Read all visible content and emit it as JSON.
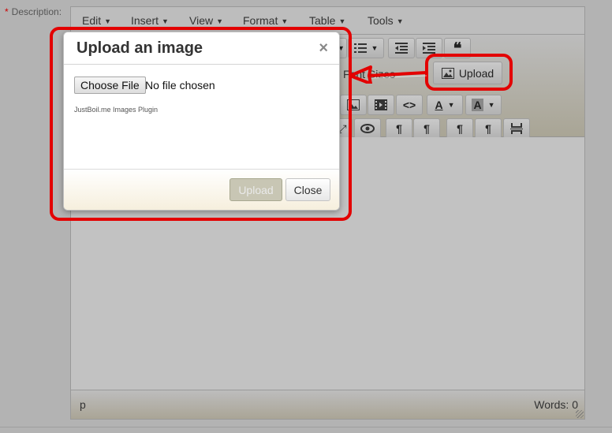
{
  "form": {
    "required_mark": "*",
    "description_label": "Description:"
  },
  "menubar": {
    "items": [
      "Edit",
      "Insert",
      "View",
      "Format",
      "Table",
      "Tools"
    ]
  },
  "toolbar": {
    "font_sizes_label": "Font Sizes",
    "upload_label": "Upload",
    "font_color_letter": "A",
    "bg_color_letter": "A"
  },
  "statusbar": {
    "path": "p",
    "word_count": "Words: 0"
  },
  "dialog": {
    "title": "Upload an image",
    "close_x": "×",
    "choose_file_label": "Choose File",
    "file_status": "No file chosen",
    "plugin_credit": "JustBoil.me Images Plugin",
    "upload_label": "Upload",
    "close_label": "Close"
  },
  "colors": {
    "annotation_red": "#e30000",
    "overlay_gray": "#b3b3b3",
    "dialog_footer": "#f6efdd"
  }
}
